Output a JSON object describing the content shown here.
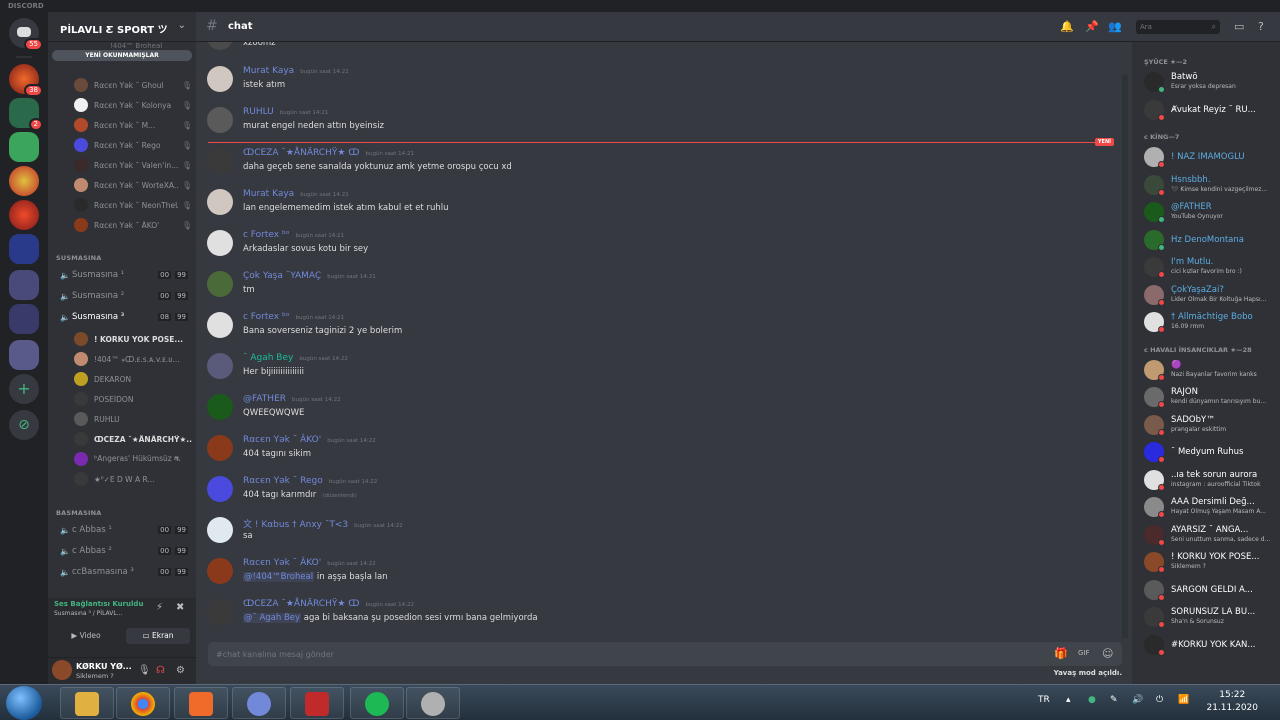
{
  "window": {
    "brand": "DISCORD"
  },
  "guild_rail": {
    "home_badge": "55",
    "badges": [
      {
        "index": 1,
        "value": "38"
      },
      {
        "index": 2,
        "value": "2"
      }
    ]
  },
  "server": {
    "name": "PİLAVLI Ƹ SPORT ツ",
    "unread_pill": "YENİ OKUNMAMIŞLAR",
    "partial_top": "!404™ Broheal",
    "sidebar_members": [
      {
        "name": "!404™ Broheal",
        "color": "#5a3a2a"
      },
      {
        "name": "Rαcєn Yək ˘ Ghoul",
        "color": "#6a4a3a"
      },
      {
        "name": "Rαcєn Yək ˘ Kolonya",
        "color": "#f0f0f0"
      },
      {
        "name": "Rαcєn Yək ˘ M...",
        "color": "#b04a2a"
      },
      {
        "name": "Rαcєn Yək ˘ Rego",
        "color": "#4a4adf"
      },
      {
        "name": "Rαcєn Yək ˘ Valen'in...",
        "color": "#3a2a2a"
      },
      {
        "name": "Rαcєn Yək ˘ WorteXA...",
        "color": "#c08a70"
      },
      {
        "name": "Rαcєn Yək ˘ NeonThеU...",
        "color": "#2a2a2a"
      },
      {
        "name": "Rαcєn Yək ˘ ÂKO'",
        "color": "#8a3a1a"
      }
    ],
    "category_1": "SUSMASINA",
    "voice_1": [
      {
        "name": "Susmasına ¹",
        "a": "00",
        "b": "99"
      },
      {
        "name": "Susmasına ²",
        "a": "00",
        "b": "99"
      },
      {
        "name": "Susmasına ³",
        "a": "08",
        "b": "99"
      }
    ],
    "voice_members": [
      {
        "name": "! KORKU YOK POSE...",
        "color": "#7a4a2a",
        "bright": true
      },
      {
        "name": "!404™ ⁎ↀ.ᴇ.s.ᴀ.v.ᴇ.ᴜ...",
        "color": "#c08a70",
        "bright": false
      },
      {
        "name": "DEKARON",
        "color": "#c0a020",
        "bright": false
      },
      {
        "name": "POSEİDON",
        "color": "#3a3a3a",
        "bright": false
      },
      {
        "name": "RUHLU",
        "color": "#5a5a5a",
        "bright": false
      },
      {
        "name": "ↀCEZA ˘★ÅNÄRCHŸ★...",
        "color": "#3a3a3a",
        "bright": true
      },
      {
        "name": "ᵇAngeras' Hükümsüz ⛐",
        "color": "#7a2aaf",
        "bright": false
      },
      {
        "name": "★ᴾ✓E D W A R...",
        "color": "#3a3a3a",
        "bright": false
      }
    ],
    "category_2": "BASMASINA",
    "voice_2": [
      {
        "name": "ϲ Abbas ¹",
        "a": "00",
        "b": "99"
      },
      {
        "name": "ϲ Abbas ²",
        "a": "00",
        "b": "99"
      },
      {
        "name": "ϲϲBasmasına ³",
        "a": "00",
        "b": "99"
      }
    ]
  },
  "voice_panel": {
    "status": "Ses Bağlantısı Kuruldu",
    "channel": "Susmasına ³ / PİLAVL...",
    "video_label": "Video",
    "screen_label": "Ekran"
  },
  "user_panel": {
    "name": "KØRKU YØ...",
    "tag": "Siklemem ?"
  },
  "channel": {
    "name": "chat",
    "search_placeholder": "Ara"
  },
  "messages": [
    {
      "author": "",
      "time": "",
      "text": "xzöömz",
      "avatar": "#4a4a4a",
      "author_color": "#dcddde"
    },
    {
      "author": "Murat Kaya",
      "time": "bugün saat 14:21",
      "text": "istek atım",
      "avatar": "#d0c8c0",
      "author_color": "#7289da"
    },
    {
      "author": "RUHLU",
      "time": "bugün saat 14:21",
      "text": "murat engel neden attın byeinsiz",
      "avatar": "#5a5a5a",
      "author_color": "#7289da"
    },
    {
      "author": "ↀCEZA ˘★ÅNÄRCHŸ★ ↀ",
      "time": "bugün saat 14:21",
      "text": "daha  geçeb sene sanalda yoktunuz amk yetme orospu çocu xd",
      "avatar": "#3a3a3a",
      "author_color": "#7289da"
    },
    {
      "author": "Murat Kaya",
      "time": "bugün saat 14:21",
      "text": "lan engelememedim istek atım kabul et et ruhlu",
      "avatar": "#d0c8c0",
      "author_color": "#7289da"
    },
    {
      "author": "ϲ Fortex ᵇᵒ",
      "time": "bugün saat 14:21",
      "text": "Arkadaslar sovus kotu bir sey",
      "avatar": "#e0e0e0",
      "author_color": "#7289da"
    },
    {
      "author": "Çok Yaşa ˘YAMAÇ",
      "time": "bugün saat 14:21",
      "text": "tm",
      "avatar": "#4a6a3a",
      "author_color": "#7289da"
    },
    {
      "author": "ϲ Fortex ᵇᵒ",
      "time": "bugün saat 14:21",
      "text": "Bana soverseniz taginizi 2 ye bolerim",
      "avatar": "#e0e0e0",
      "author_color": "#7289da"
    },
    {
      "author": "˘ Agah Bey",
      "time": "bugün saat 14:22",
      "text": "Her bijiiiiiiiiiiiiii",
      "avatar": "#5a5a7a",
      "author_color": "#1abc9c"
    },
    {
      "author": "@FATHER",
      "time": "bugün saat 14:22",
      "text": "QWEEQWQWE",
      "avatar": "#1a5a1a",
      "author_color": "#7289da"
    },
    {
      "author": "Rαcєn Yək ˘ ÂKO'",
      "time": "bugün saat 14:22",
      "text": "404 tagını sikim",
      "avatar": "#8a3a1a",
      "author_color": "#7289da"
    },
    {
      "author": "Rαcєn Yək ˘ Rego",
      "time": "bugün saat 14:22",
      "text": "404 tagı karımdır",
      "edited": "(düzenlendi)",
      "avatar": "#4a4adf",
      "author_color": "#7289da"
    },
    {
      "author": "文 ! Kαbus † Anxy ˘T<3",
      "time": "bugün saat 14:22",
      "text": "sa",
      "avatar": "#e0e8f0",
      "author_color": "#7289da"
    },
    {
      "author": "Rαcєn Yək ˘ ÂKO'",
      "time": "bugün saat 14:22",
      "mention": "@!404™Broheal",
      "text": " in aşşa başla lan",
      "avatar": "#8a3a1a",
      "author_color": "#7289da"
    },
    {
      "author": "ↀCEZA ˘★ÅNÄRCHŸ★ ↀ",
      "time": "bugün saat 14:22",
      "mention": "@˘ Agah Bey",
      "text": " aga bi baksana şu posedion sesi vrmı bana gelmiyorda",
      "avatar": "#3a3a3a",
      "author_color": "#7289da"
    }
  ],
  "new_divider": "YENİ",
  "composer": {
    "placeholder": "#chat kanalına mesaj gönder",
    "slowmode": "Yavaş mod açıldı."
  },
  "member_groups": [
    {
      "label": "ŞYÜCE ★—2",
      "members": [
        {
          "name": "Batwö",
          "status": "Esrar yoksa depresan",
          "color": "#fff",
          "avatar": "#2a2a2a",
          "dot": "#43b581"
        },
        {
          "name": "Ⱥvukat Reyiz ˘ RU...",
          "status": "",
          "color": "#fff",
          "avatar": "#3a3a3a",
          "dot": "#f04747"
        }
      ]
    },
    {
      "label": "ϲ KİNG—7",
      "members": [
        {
          "name": "! NAZ İMAMOĞLU",
          "status": "",
          "color": "#5dade2",
          "avatar": "#b0b0b0",
          "dot": "#f04747"
        },
        {
          "name": "Hsnsbbh.",
          "status": "🖤 Kimse kendini vazgeçilmez...",
          "color": "#5dade2",
          "avatar": "#3a4a3a",
          "dot": "#f04747"
        },
        {
          "name": "@FATHER",
          "status": "YouTube Oynuyor",
          "color": "#5dade2",
          "avatar": "#1a5a1a",
          "dot": "#43b581"
        },
        {
          "name": "Hz DenoMontana",
          "status": "",
          "color": "#5dade2",
          "avatar": "#2a6a2a",
          "dot": "#43b581"
        },
        {
          "name": "I'm Mutlu.",
          "status": "cici kızlar favorim bro :)",
          "color": "#5dade2",
          "avatar": "#3a3a3a",
          "dot": "#f04747"
        },
        {
          "name": "ÇokYaşaZai?",
          "status": "Lider Olmak Bir Koltuğa Hapsı...",
          "color": "#5dade2",
          "avatar": "#8a6a6a",
          "dot": "#f04747"
        },
        {
          "name": "† Allmächtige Bobo",
          "status": "16.09 rmm",
          "color": "#5dade2",
          "avatar": "#e0e0e0",
          "dot": "#f04747"
        }
      ]
    },
    {
      "label": "ϲ HAVALI İNSANCIKLAR ★—28",
      "members": [
        {
          "name": "🟣",
          "status": "Nazi Bayanlar favorim kanks",
          "color": "#fff",
          "avatar": "#c09a70",
          "dot": "#f04747"
        },
        {
          "name": "RAJON",
          "status": "kendi dünyamın tanrısıyım bu...",
          "color": "#fff",
          "avatar": "#6a6a6a",
          "dot": "#f04747"
        },
        {
          "name": "SADObY™",
          "status": "prangalar eskittim",
          "color": "#fff",
          "avatar": "#7a5a4a",
          "dot": "#f04747"
        },
        {
          "name": "˘ Medyum Ruhus",
          "status": "",
          "color": "#fff",
          "avatar": "#2a2adf",
          "dot": "#f04747"
        },
        {
          "name": "..ıa tek sorun aurora",
          "status": "instagram : auroofficial Tiktok",
          "color": "#fff",
          "avatar": "#e0e0e0",
          "dot": "#f04747"
        },
        {
          "name": "AAA Dersimli Değ...",
          "status": "Hayat Olmuş Yaşam Masam A...",
          "color": "#fff",
          "avatar": "#8a8a8a",
          "dot": "#f04747"
        },
        {
          "name": "AYARSIZ ˘ ANGA...",
          "status": "Seni unuttum sanma, sadece d...",
          "color": "#fff",
          "avatar": "#4a2a2a",
          "dot": "#f04747"
        },
        {
          "name": "! KORKU YOK POSE...",
          "status": "Siklemem ?",
          "color": "#fff",
          "avatar": "#8a4a2a",
          "dot": "#f04747"
        },
        {
          "name": "SARGON GELDİ A...",
          "status": "",
          "color": "#fff",
          "avatar": "#5a5a5a",
          "dot": "#f04747"
        },
        {
          "name": "SORUNSUZ LA BU...",
          "status": "Sha'n & Sorunsuz",
          "color": "#fff",
          "avatar": "#3a3a3a",
          "dot": "#f04747"
        },
        {
          "name": "#KORKU YOK KAN...",
          "status": "",
          "color": "#fff",
          "avatar": "#2a2a2a",
          "dot": "#f04747"
        }
      ]
    }
  ],
  "taskbar": {
    "lang": "TR",
    "time": "15:22",
    "date": "21.11.2020"
  }
}
